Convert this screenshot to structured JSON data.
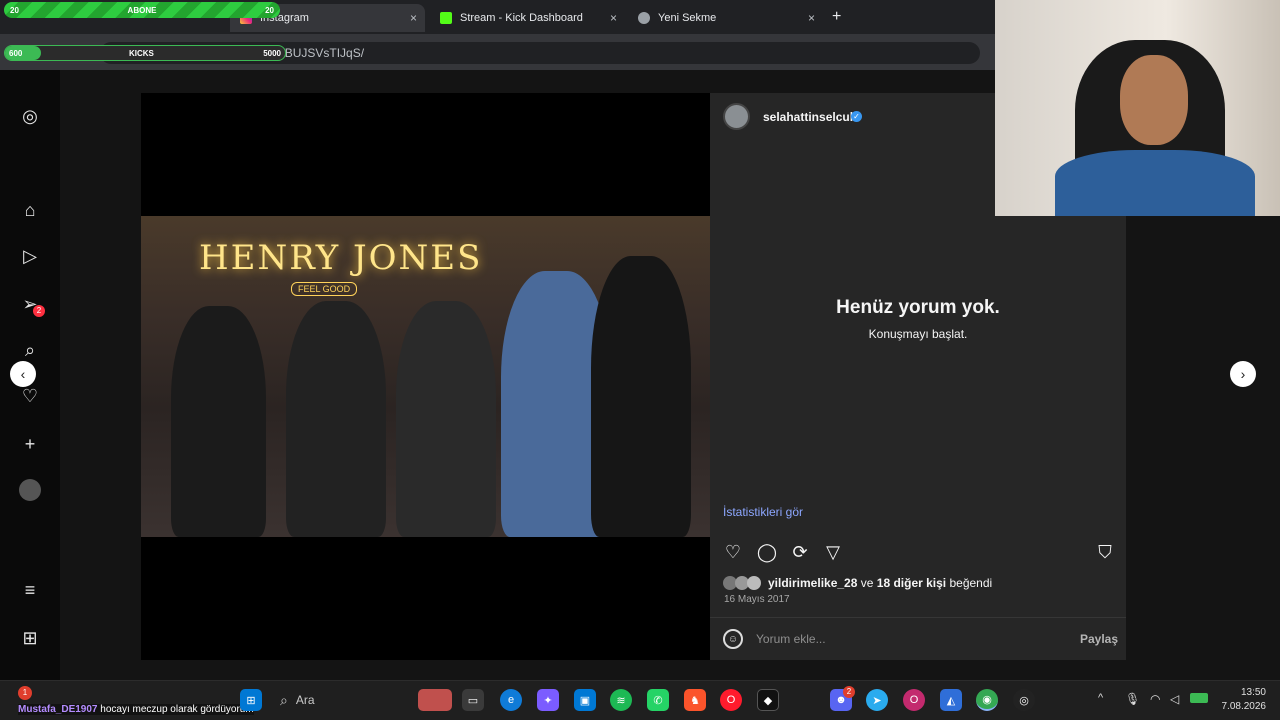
{
  "browser": {
    "tabs": [
      {
        "label": "Instagram",
        "active": true
      },
      {
        "label": "Stream - Kick Dashboard",
        "active": false
      },
      {
        "label": "Yeni Sekme",
        "active": false
      }
    ],
    "url": "https://www.instagram.com/p/BUJSVsTIJqS/",
    "url_display": "www.instagram.com/p/BUJSVsTIJqS/",
    "new_tab": "+",
    "close": "×"
  },
  "overlay": {
    "bar1_left": "20",
    "bar1_center": "ABONE",
    "bar1_right": "20",
    "bar2_left": "600",
    "bar2_center": "KICKS",
    "bar2_right": "5000"
  },
  "post": {
    "author": "selahattinselcuk",
    "photo_sign": "HENRY JONES",
    "photo_sub": "FEEL GOOD",
    "empty_title": "Henüz yorum yok.",
    "empty_subtitle": "Konuşmayı başlat.",
    "insights": "İstatistikleri gör",
    "likes_user": "yildirimelike_28",
    "likes_joiner": "ve",
    "likes_others": "18 diğer kişi",
    "likes_suffix": "beğendi",
    "date": "16 Mayıs 2017",
    "comment_placeholder": "Yorum ekle...",
    "share": "Paylaş"
  },
  "nav": {
    "notification_count": "2"
  },
  "taskbar": {
    "search": "Ara",
    "time": "13:50",
    "date": "7.08.2026",
    "discord_badge": "2"
  },
  "chat": {
    "user": "Mustafa_DE1907",
    "message": "hocayı meczup olarak gördüyorum",
    "badge": "1"
  },
  "colors": {
    "verified": "#3897f0",
    "insights": "#8da7ff",
    "overlay_green": "#2ecc40"
  }
}
